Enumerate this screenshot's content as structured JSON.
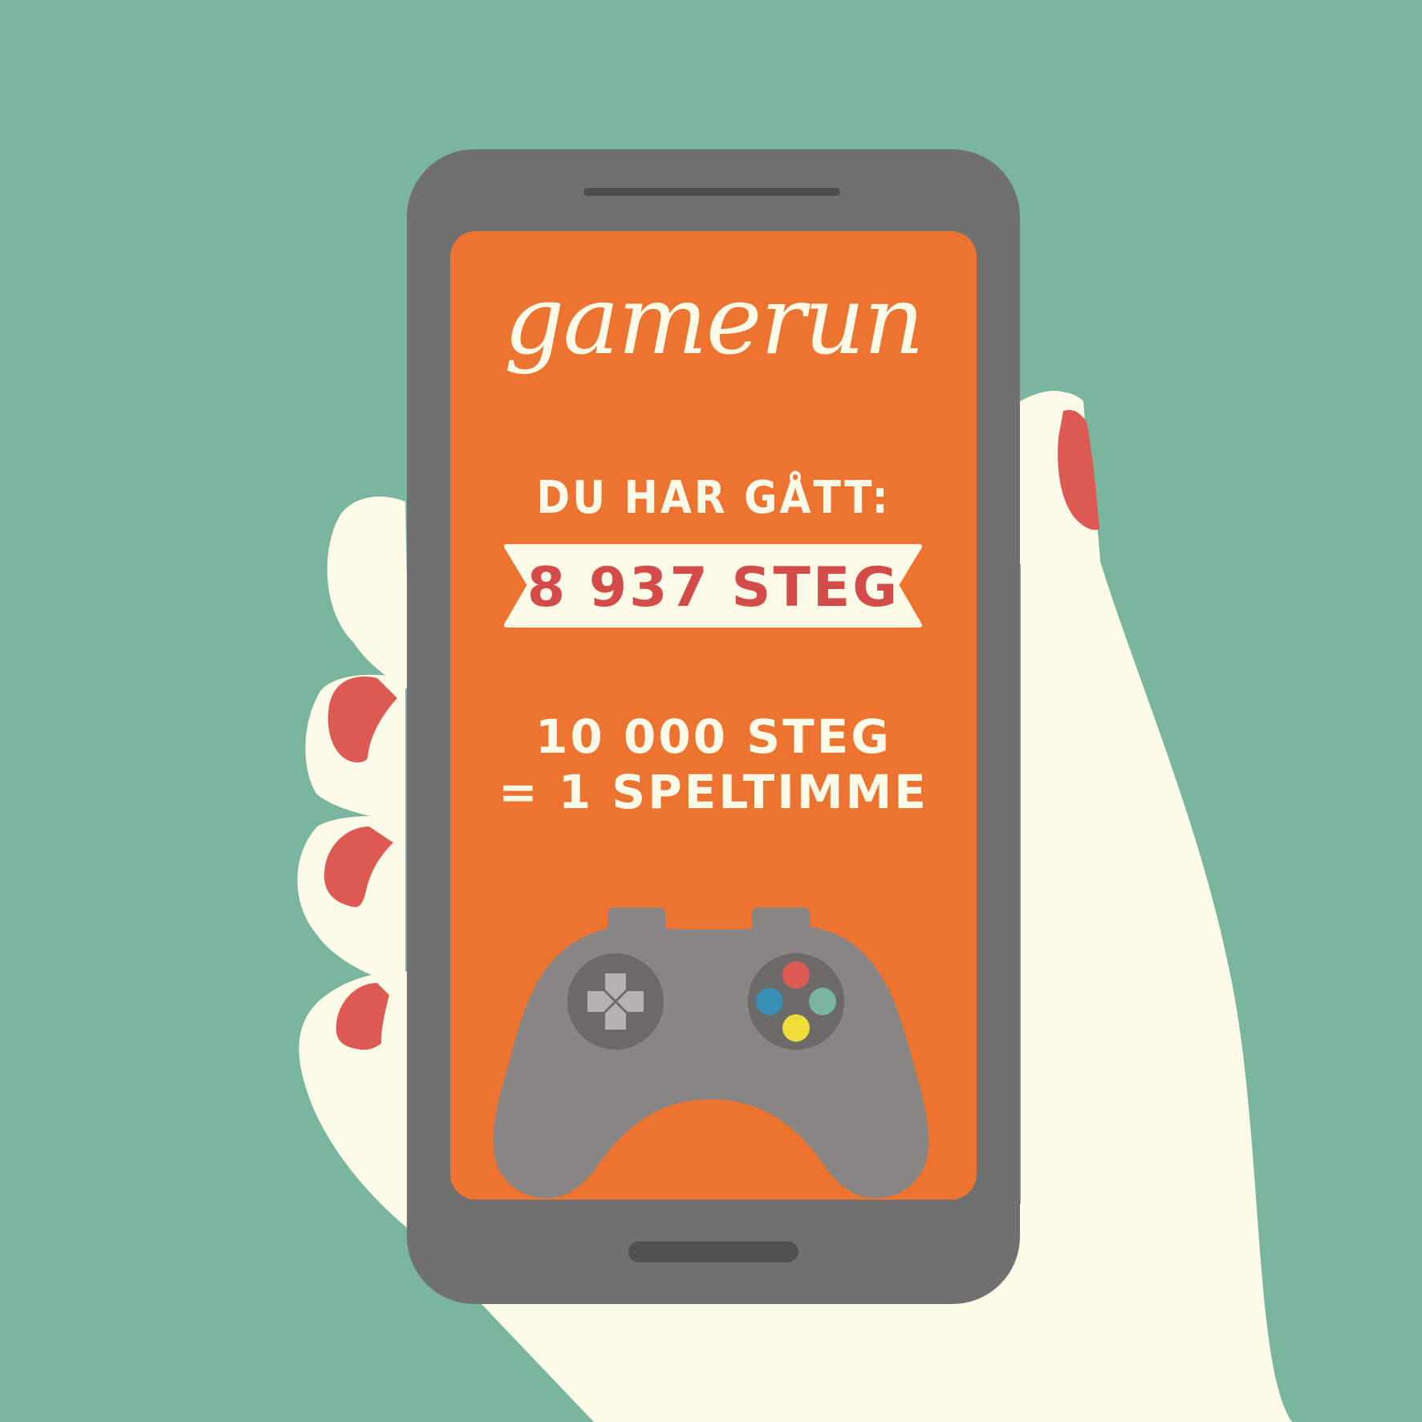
{
  "app": {
    "logo_text": "gamerun"
  },
  "screen": {
    "walked_label": "DU HAR GÅTT:",
    "step_count": "8 937 STEG",
    "goal_line_1": "10 000 STEG",
    "goal_line_2": "= 1 SPELTIMME"
  },
  "icons": {
    "controller": "gamepad-icon",
    "dpad": "dpad-icon",
    "buttons": "face-buttons-icon"
  },
  "colors": {
    "background": "#7ab69d",
    "phone_body": "#717070",
    "screen": "#ed7331",
    "cream": "#fefbe9",
    "nail": "#dd5a54",
    "controller": "#878685",
    "button_red": "#dd5a54",
    "button_blue": "#3a8fb5",
    "button_green": "#7ab69d",
    "button_yellow": "#f0dc3a"
  }
}
